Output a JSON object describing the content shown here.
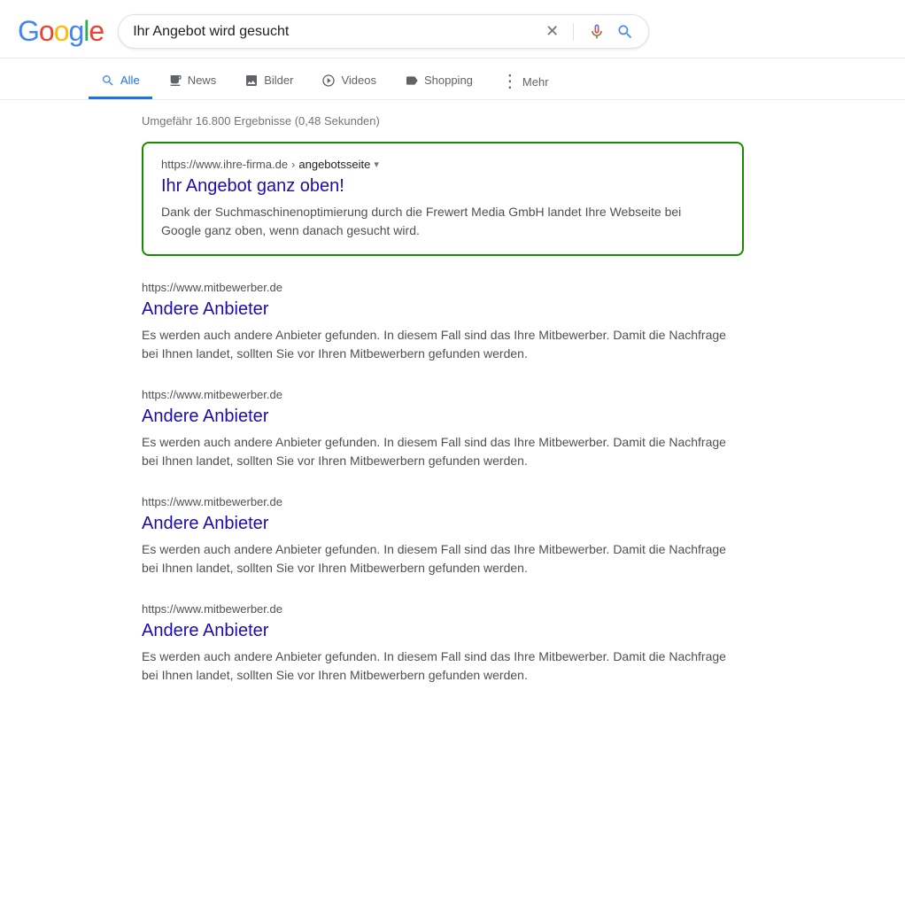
{
  "header": {
    "logo": {
      "g1": "G",
      "o1": "o",
      "o2": "o",
      "g2": "g",
      "l": "l",
      "e": "e"
    },
    "search_query": "Ihr Angebot wird gesucht",
    "clear_label": "×",
    "mic_label": "Spracheingabe",
    "search_label": "Suche"
  },
  "nav": {
    "tabs": [
      {
        "id": "alle",
        "label": "Alle",
        "icon": "🔍",
        "active": true
      },
      {
        "id": "news",
        "label": "News",
        "icon": "📰",
        "active": false
      },
      {
        "id": "bilder",
        "label": "Bilder",
        "icon": "🖼",
        "active": false
      },
      {
        "id": "videos",
        "label": "Videos",
        "icon": "▶",
        "active": false
      },
      {
        "id": "shopping",
        "label": "Shopping",
        "icon": "🏷",
        "active": false
      },
      {
        "id": "mehr",
        "label": "Mehr",
        "icon": "⋮",
        "active": false
      }
    ]
  },
  "results": {
    "stats": "Umgefähr 16.800 Ergebnisse (0,48 Sekunden)",
    "items": [
      {
        "id": "featured",
        "url": "https://www.ihre-firma.de",
        "url_path": "angebotsseite",
        "title": "Ihr Angebot ganz oben!",
        "snippet": "Dank der Suchmaschinenoptimierung durch die Frewert Media GmbH landet Ihre Webseite bei Google ganz oben, wenn danach gesucht wird.",
        "featured": true
      },
      {
        "id": "result2",
        "url": "https://www.mitbewerber.de",
        "url_path": "",
        "title": "Andere Anbieter",
        "snippet": "Es werden auch andere Anbieter gefunden. In diesem Fall sind das Ihre Mitbewerber. Damit die Nachfrage bei Ihnen landet, sollten Sie vor Ihren Mitbewerbern gefunden werden.",
        "featured": false
      },
      {
        "id": "result3",
        "url": "https://www.mitbewerber.de",
        "url_path": "",
        "title": "Andere Anbieter",
        "snippet": "Es werden auch andere Anbieter gefunden. In diesem Fall sind das Ihre Mitbewerber. Damit die Nachfrage bei Ihnen landet, sollten Sie vor Ihren Mitbewerbern gefunden werden.",
        "featured": false
      },
      {
        "id": "result4",
        "url": "https://www.mitbewerber.de",
        "url_path": "",
        "title": "Andere Anbieter",
        "snippet": "Es werden auch andere Anbieter gefunden. In diesem Fall sind das Ihre Mitbewerber. Damit die Nachfrage bei Ihnen landet, sollten Sie vor Ihren Mitbewerbern gefunden werden.",
        "featured": false
      },
      {
        "id": "result5",
        "url": "https://www.mitbewerber.de",
        "url_path": "",
        "title": "Andere Anbieter",
        "snippet": "Es werden auch andere Anbieter gefunden. In diesem Fall sind das Ihre Mitbewerber. Damit die Nachfrage bei Ihnen landet, sollten Sie vor Ihren Mitbewerbern gefunden werden.",
        "featured": false
      }
    ]
  }
}
